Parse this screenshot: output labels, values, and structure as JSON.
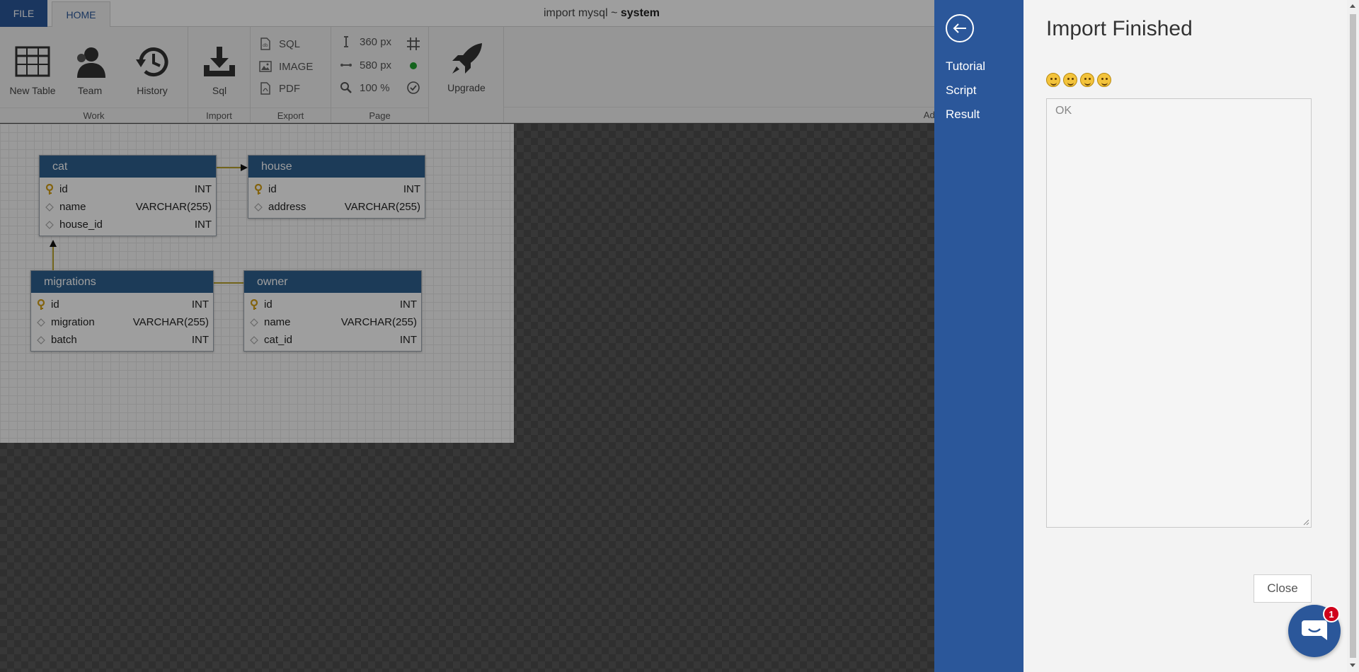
{
  "titlebar": {
    "file_tab": "FILE",
    "home_tab": "HOME",
    "title_prefix": "import mysql ~ ",
    "title_db": "system"
  },
  "ribbon": {
    "work": {
      "label": "Work",
      "new_table": "New Table",
      "team": "Team",
      "history": "History"
    },
    "import": {
      "label": "Import",
      "sql": "Sql"
    },
    "export": {
      "label": "Export",
      "sql": "SQL",
      "image": "IMAGE",
      "pdf": "PDF"
    },
    "page": {
      "label": "Page",
      "width": "360 px",
      "height": "580 px",
      "zoom": "100 %"
    },
    "upgrade": "Upgrade",
    "ads_label": "Ads"
  },
  "tables": [
    {
      "name": "cat",
      "columns": [
        {
          "name": "id",
          "type": "INT",
          "pk": true
        },
        {
          "name": "name",
          "type": "VARCHAR(255)",
          "pk": false
        },
        {
          "name": "house_id",
          "type": "INT",
          "pk": false
        }
      ]
    },
    {
      "name": "house",
      "columns": [
        {
          "name": "id",
          "type": "INT",
          "pk": true
        },
        {
          "name": "address",
          "type": "VARCHAR(255)",
          "pk": false
        }
      ]
    },
    {
      "name": "migrations",
      "columns": [
        {
          "name": "id",
          "type": "INT",
          "pk": true
        },
        {
          "name": "migration",
          "type": "VARCHAR(255)",
          "pk": false
        },
        {
          "name": "batch",
          "type": "INT",
          "pk": false
        }
      ]
    },
    {
      "name": "owner",
      "columns": [
        {
          "name": "id",
          "type": "INT",
          "pk": true
        },
        {
          "name": "name",
          "type": "VARCHAR(255)",
          "pk": false
        },
        {
          "name": "cat_id",
          "type": "INT",
          "pk": false
        }
      ]
    }
  ],
  "dialog": {
    "nav": {
      "tutorial": "Tutorial",
      "script": "Script",
      "result": "Result"
    },
    "title": "Import Finished",
    "result_text": "OK",
    "close_label": "Close"
  },
  "chat": {
    "badge_count": "1"
  },
  "colors": {
    "accent": "#2b579a",
    "table_header": "#2e5f8f",
    "key": "#d4a017"
  }
}
